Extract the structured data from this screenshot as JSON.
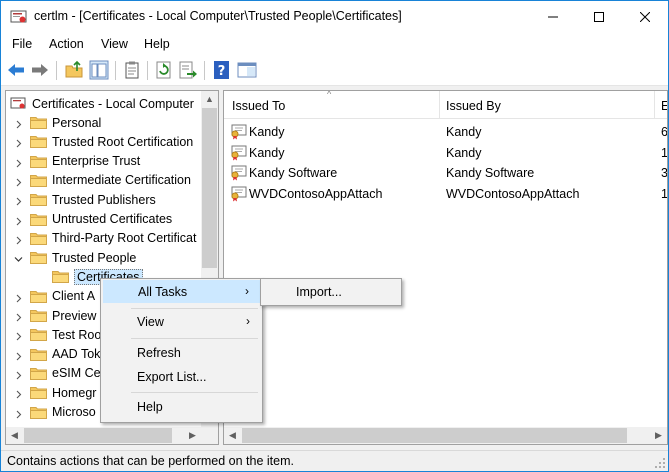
{
  "window": {
    "title": "certlm - [Certificates - Local Computer\\Trusted People\\Certificates]"
  },
  "menubar": {
    "items": [
      "File",
      "Action",
      "View",
      "Help"
    ]
  },
  "tree": {
    "root": "Certificates - Local Computer",
    "items": [
      "Personal",
      "Trusted Root Certification",
      "Enterprise Trust",
      "Intermediate Certification",
      "Trusted Publishers",
      "Untrusted Certificates",
      "Third-Party Root Certificat",
      "Trusted People",
      "Certificates",
      "Client A",
      "Preview",
      "Test Roo",
      "AAD Tok",
      "eSIM Ce",
      "Homegr",
      "Microso"
    ]
  },
  "list": {
    "columns": [
      "Issued To",
      "Issued By",
      "E"
    ],
    "rows": [
      {
        "issued_to": "Kandy",
        "issued_by": "Kandy",
        "exp": "6"
      },
      {
        "issued_to": "Kandy",
        "issued_by": "Kandy",
        "exp": "1"
      },
      {
        "issued_to": "Kandy Software",
        "issued_by": "Kandy Software",
        "exp": "3"
      },
      {
        "issued_to": "WVDContosoAppAttach",
        "issued_by": "WVDContosoAppAttach",
        "exp": "1"
      }
    ]
  },
  "context_menu": {
    "items": [
      "All Tasks",
      "View",
      "Refresh",
      "Export List...",
      "Help"
    ],
    "submenu_arrow": "›"
  },
  "submenu": {
    "items": [
      "Import..."
    ]
  },
  "statusbar": {
    "text": "Contains actions that can be performed on the item."
  },
  "colors": {
    "accent_border": "#1883d7",
    "selection": "#cce8ff",
    "folder": "#f4c75e"
  }
}
